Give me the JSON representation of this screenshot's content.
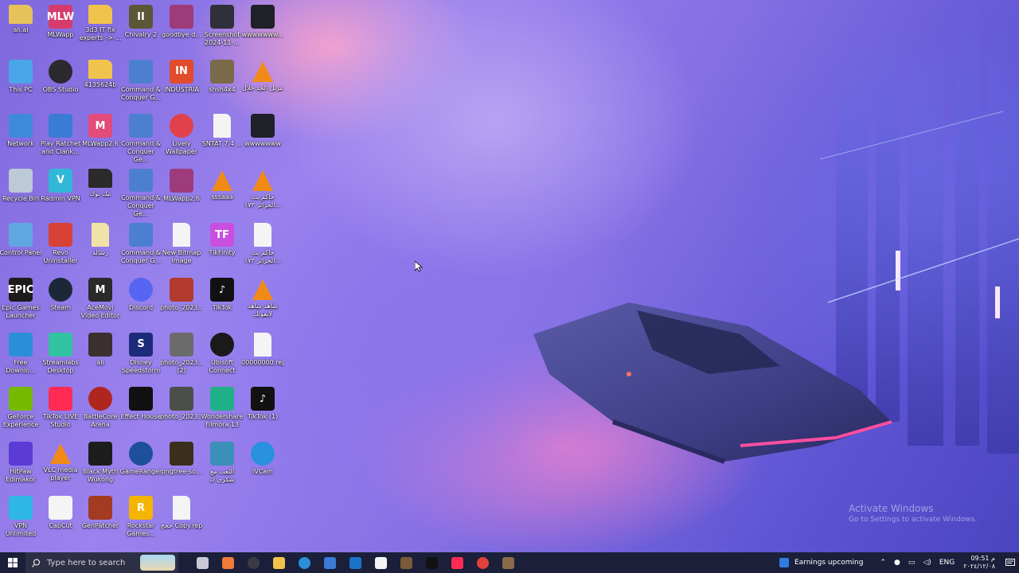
{
  "desktop": {
    "icons": [
      {
        "label": "ali.al",
        "glyph": "folder-user",
        "color": "#e7c25a"
      },
      {
        "label": "MLWapp",
        "glyph": "mlwapp",
        "color": "#d63b6e",
        "text": "MLW"
      },
      {
        "label": "3d3 IT fix  experts ->-...",
        "glyph": "folder",
        "color": "#f0c44c"
      },
      {
        "label": "Chivalry 2",
        "glyph": "shield",
        "color": "#5b5636",
        "text": "II"
      },
      {
        "label": "goodbye d...",
        "glyph": "rar",
        "color": "#9d3b7b"
      },
      {
        "label": "Screenshot 2024-11-...",
        "glyph": "image",
        "color": "#30303a"
      },
      {
        "label": "wwwwwww...",
        "glyph": "image",
        "color": "#202028"
      },
      {
        "label": "This PC",
        "glyph": "monitor",
        "color": "#4aa6e8"
      },
      {
        "label": "OBS Studio",
        "glyph": "obs",
        "color": "#2a2a2e"
      },
      {
        "label": "4135624b",
        "glyph": "folder",
        "color": "#f0c44c"
      },
      {
        "label": "Command & Conquer G...",
        "glyph": "eagle",
        "color": "#4d7fd1"
      },
      {
        "label": "INDUSTRIA",
        "glyph": "industria",
        "color": "#e24b2c",
        "text": "IN"
      },
      {
        "label": "shsh4x4",
        "glyph": "image",
        "color": "#7a6a4a"
      },
      {
        "label": "تنزيل الجد خلال",
        "glyph": "vlc",
        "color": "#f28a17"
      },
      {
        "label": "Network",
        "glyph": "network",
        "color": "#3d8ad8"
      },
      {
        "label": "Play Ratchet and Clank...",
        "glyph": "window",
        "color": "#3a7bd5"
      },
      {
        "label": "MLWapp2.6",
        "glyph": "mlwapp",
        "color": "#e24b7a",
        "text": "M"
      },
      {
        "label": "Command & Conquer Ge...",
        "glyph": "eagle",
        "color": "#4d7fd1"
      },
      {
        "label": "Lively Wallpaper",
        "glyph": "lively",
        "color": "#e0414a"
      },
      {
        "label": "SNTAT 7.4 ...",
        "glyph": "file",
        "color": "#f4f4f4"
      },
      {
        "label": "wwwwwww",
        "glyph": "image",
        "color": "#202028"
      },
      {
        "label": "Recycle Bin",
        "glyph": "bin",
        "color": "#bcc9d6"
      },
      {
        "label": "Radmin VPN",
        "glyph": "vpn",
        "color": "#31b8d8",
        "text": "V"
      },
      {
        "label": "تيك توك",
        "glyph": "folder-dark",
        "color": "#2b2b2b"
      },
      {
        "label": "Command & Conquer Ge...",
        "glyph": "eagle",
        "color": "#4d7fd1"
      },
      {
        "label": "MLWapp2.6",
        "glyph": "rar",
        "color": "#9d3b7b"
      },
      {
        "label": "sssaaa",
        "glyph": "vlc",
        "color": "#f28a17"
      },
      {
        "label": "حاكم بث الجزائر ١٧٣...",
        "glyph": "vlc",
        "color": "#f28a17"
      },
      {
        "label": "Control Panel",
        "glyph": "control",
        "color": "#5fa7e0"
      },
      {
        "label": "Revo Uninstaller",
        "glyph": "revo",
        "color": "#d84236"
      },
      {
        "label": "رسالة",
        "glyph": "file-yellow",
        "color": "#f1e2a8"
      },
      {
        "label": "Command & Conquer G...",
        "glyph": "eagle",
        "color": "#4d7fd1"
      },
      {
        "label": "New Bitmap Image",
        "glyph": "bitmap",
        "color": "#f4f4f4"
      },
      {
        "label": "TikFinity",
        "glyph": "tikfinity",
        "color": "#c94fe0",
        "text": "TF"
      },
      {
        "label": "حاكم بث الجزائر ١٧٣...",
        "glyph": "video",
        "color": "#f4f4f4"
      },
      {
        "label": "Epic Games Launcher",
        "glyph": "epic",
        "color": "#1c1c1c",
        "text": "EPIC"
      },
      {
        "label": "Steam",
        "glyph": "steam",
        "color": "#1b2838"
      },
      {
        "label": "AceMovi Video Editor",
        "glyph": "acemovi",
        "color": "#2a2a2a",
        "text": "M"
      },
      {
        "label": "Discord",
        "glyph": "discord",
        "color": "#5865f2"
      },
      {
        "label": "photo_2023...",
        "glyph": "photo",
        "color": "#b33a2f"
      },
      {
        "label": "TikTok",
        "glyph": "tiktok",
        "color": "#111111",
        "text": "♪"
      },
      {
        "label": "شاهد شاهد لايفوتك",
        "glyph": "vlc",
        "color": "#f28a17"
      },
      {
        "label": "Free Downlo...",
        "glyph": "download",
        "color": "#2a8fd8"
      },
      {
        "label": "Streamlabs Desktop",
        "glyph": "streamlabs",
        "color": "#31c3a2"
      },
      {
        "label": "ali",
        "glyph": "photo",
        "color": "#3a3030"
      },
      {
        "label": "Disney Speedstorm",
        "glyph": "speedstorm",
        "color": "#1c2a7a",
        "text": "S"
      },
      {
        "label": "photo_2023... (2)",
        "glyph": "photo",
        "color": "#6b6b6b"
      },
      {
        "label": "Ubisoft Connect",
        "glyph": "ubisoft",
        "color": "#1a1a1a"
      },
      {
        "label": "00000000.rep",
        "glyph": "file",
        "color": "#f4f4f4"
      },
      {
        "label": "GeForce Experience",
        "glyph": "nvidia",
        "color": "#76b900"
      },
      {
        "label": "TikTok LIVE Studio",
        "glyph": "tiktok-live",
        "color": "#fe2c55"
      },
      {
        "label": "BattleCore Arena",
        "glyph": "battlecore",
        "color": "#b0261f"
      },
      {
        "label": "Effect House",
        "glyph": "effect",
        "color": "#111111"
      },
      {
        "label": "photo_2023...",
        "glyph": "photo",
        "color": "#4a4f4a"
      },
      {
        "label": "Wondershare Filmora 13",
        "glyph": "filmora",
        "color": "#20b088"
      },
      {
        "label": "TikTok (1)",
        "glyph": "tiktok",
        "color": "#111111",
        "text": "♪"
      },
      {
        "label": "HitPaw Edimakor",
        "glyph": "hitpaw",
        "color": "#5b3bd6"
      },
      {
        "label": "VLC media player",
        "glyph": "vlc",
        "color": "#f28a17"
      },
      {
        "label": "Black Myth Wukong",
        "glyph": "wukong",
        "color": "#1d1d1d"
      },
      {
        "label": "GameRanger",
        "glyph": "gameranger",
        "color": "#1d4f9a"
      },
      {
        "label": "pngtree-so...",
        "glyph": "image",
        "color": "#3a2f1a"
      },
      {
        "label": "اللعب مع شكري ك",
        "glyph": "image",
        "color": "#3b8fb8"
      },
      {
        "label": "iVCam",
        "glyph": "ivcam",
        "color": "#2a90e0"
      },
      {
        "label": "VPN Unlimited",
        "glyph": "vpn-unl",
        "color": "#2fb7e6"
      },
      {
        "label": "CapCut",
        "glyph": "capcut",
        "color": "#f4f4f4"
      },
      {
        "label": "GenPatcher",
        "glyph": "genpatcher",
        "color": "#a33a22"
      },
      {
        "label": "Rockstar Games...",
        "glyph": "rockstar",
        "color": "#f5b400",
        "text": "R"
      },
      {
        "label": "حجج Copy.rep",
        "glyph": "file",
        "color": "#f4f4f4"
      }
    ]
  },
  "watermark": {
    "title": "Activate Windows",
    "subtitle": "Go to Settings to activate Windows."
  },
  "taskbar": {
    "search_placeholder": "Type here to search",
    "apps": [
      "task-view",
      "widgets",
      "obs",
      "file-explorer",
      "edge",
      "microsoft-store",
      "outlook",
      "capcut",
      "game",
      "tiktok",
      "tiktok-live",
      "chrome",
      "genpatcher"
    ],
    "app_colors": [
      "#c9c9d9",
      "#ef7a3a",
      "#3b3b48",
      "#f0c44c",
      "#2a8fd8",
      "#3a7bd5",
      "#1a73c8",
      "#f4f4f4",
      "#7a5a3a",
      "#111111",
      "#fe2c55",
      "#e0413a",
      "#8a6a4a"
    ],
    "news": "Earnings upcoming",
    "language": "ENG",
    "time": "09:51 م",
    "date": "٢٠٢٤/١٢/٠٨"
  }
}
